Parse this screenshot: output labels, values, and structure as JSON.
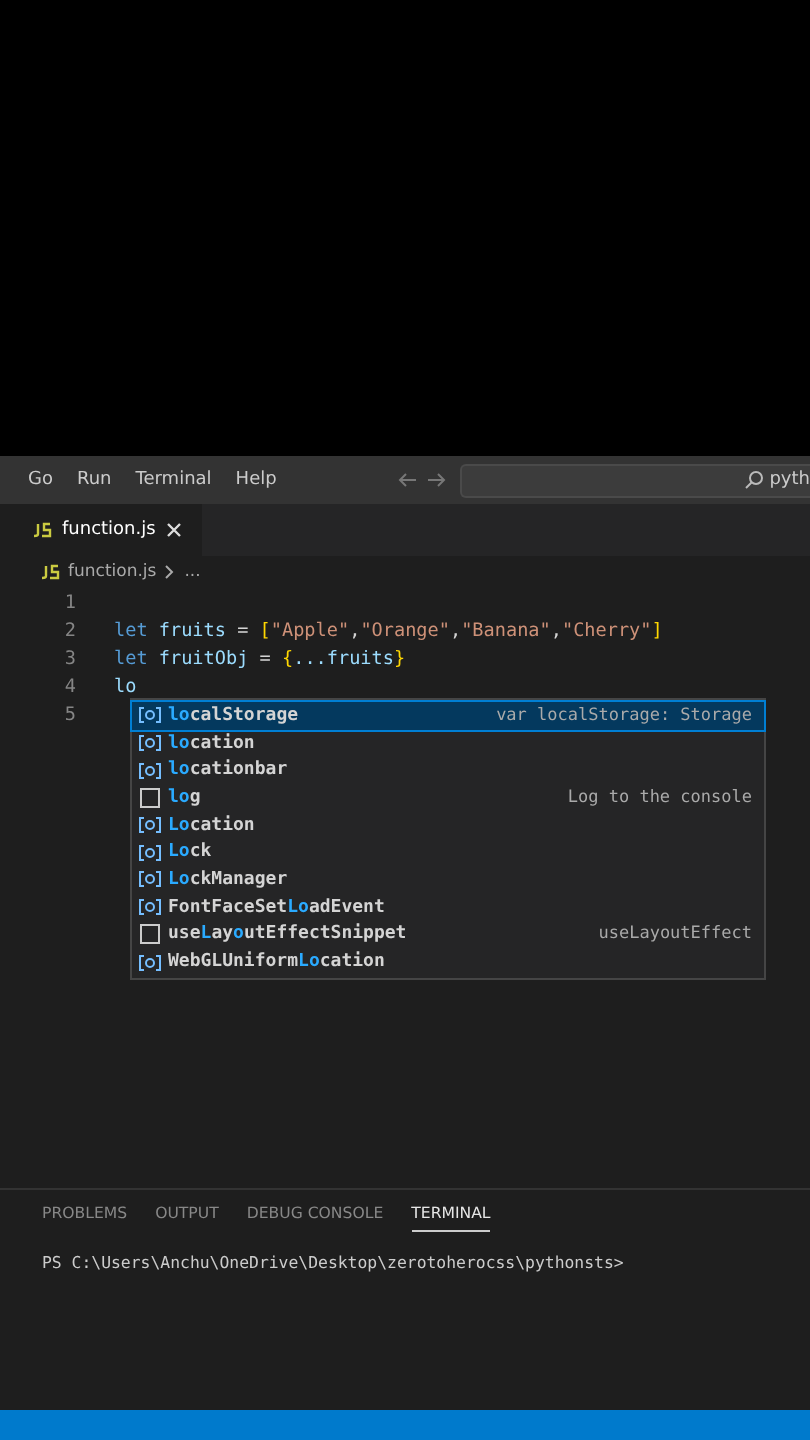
{
  "menu": [
    "Go",
    "Run",
    "Terminal",
    "Help"
  ],
  "search": {
    "value": "pyth"
  },
  "tabs": [
    {
      "label": "function.js",
      "selected": true
    }
  ],
  "breadcrumb": {
    "file": "function.js",
    "rest": "..."
  },
  "code": [
    {
      "number": "1"
    },
    {
      "number": "2",
      "tokens": [
        {
          "text": "let",
          "kind": "keyword"
        },
        {
          "text": " fruits ",
          "kind": "variable"
        },
        {
          "text": "=",
          "kind": "operator"
        },
        {
          "text": " [",
          "kind": "bracket"
        },
        {
          "text": "\"Apple\"",
          "kind": "string"
        },
        {
          "text": ",",
          "kind": "plain"
        },
        {
          "text": "\"Orange\"",
          "kind": "string"
        },
        {
          "text": ",",
          "kind": "plain"
        },
        {
          "text": "\"Banana\"",
          "kind": "string"
        },
        {
          "text": ",",
          "kind": "plain"
        },
        {
          "text": "\"Cherry\"",
          "kind": "string"
        },
        {
          "text": "]",
          "kind": "bracket"
        }
      ]
    },
    {
      "number": "3",
      "tokens": [
        {
          "text": "let",
          "kind": "keyword"
        },
        {
          "text": " fruitObj ",
          "kind": "variable"
        },
        {
          "text": "=",
          "kind": "operator"
        },
        {
          "text": " {",
          "kind": "bracket"
        },
        {
          "text": "...fruits",
          "kind": "variable"
        },
        {
          "text": "}",
          "kind": "bracket"
        }
      ]
    },
    {
      "number": "4",
      "tokens": [
        {
          "text": "lo",
          "kind": "variable"
        }
      ]
    },
    {
      "number": "5"
    }
  ],
  "suggestions": [
    {
      "kind": "variable",
      "selected": true,
      "parts": [
        {
          "text": "lo",
          "match": true
        },
        {
          "text": "calStorage",
          "match": false
        }
      ],
      "detail": "var localStorage: Storage"
    },
    {
      "kind": "variable",
      "selected": false,
      "parts": [
        {
          "text": "lo",
          "match": true
        },
        {
          "text": "cation",
          "match": false
        }
      ]
    },
    {
      "kind": "variable",
      "selected": false,
      "parts": [
        {
          "text": "lo",
          "match": true
        },
        {
          "text": "cationbar",
          "match": false
        }
      ]
    },
    {
      "kind": "snippet",
      "selected": false,
      "parts": [
        {
          "text": "lo",
          "match": true
        },
        {
          "text": "g",
          "match": false
        }
      ],
      "detail": "Log to the console"
    },
    {
      "kind": "variable",
      "selected": false,
      "parts": [
        {
          "text": "Lo",
          "match": true
        },
        {
          "text": "cation",
          "match": false
        }
      ]
    },
    {
      "kind": "variable",
      "selected": false,
      "parts": [
        {
          "text": "Lo",
          "match": true
        },
        {
          "text": "ck",
          "match": false
        }
      ]
    },
    {
      "kind": "variable",
      "selected": false,
      "parts": [
        {
          "text": "Lo",
          "match": true
        },
        {
          "text": "ckManager",
          "match": false
        }
      ]
    },
    {
      "kind": "variable",
      "selected": false,
      "parts": [
        {
          "text": "FontFaceSet",
          "match": false
        },
        {
          "text": "Lo",
          "match": true
        },
        {
          "text": "adEvent",
          "match": false
        }
      ]
    },
    {
      "kind": "snippet",
      "selected": false,
      "parts": [
        {
          "text": "use",
          "match": false
        },
        {
          "text": "L",
          "match": true
        },
        {
          "text": "ay",
          "match": false
        },
        {
          "text": "o",
          "match": true
        },
        {
          "text": "utEffectSnippet",
          "match": false
        }
      ],
      "detail": "useLayoutEffect"
    },
    {
      "kind": "variable",
      "selected": false,
      "parts": [
        {
          "text": "WebGLUniform",
          "match": false
        },
        {
          "text": "Lo",
          "match": true
        },
        {
          "text": "cation",
          "match": false
        }
      ]
    }
  ],
  "panel_tabs": [
    {
      "label": "PROBLEMS",
      "selected": false
    },
    {
      "label": "OUTPUT",
      "selected": false
    },
    {
      "label": "DEBUG CONSOLE",
      "selected": false
    },
    {
      "label": "TERMINAL",
      "selected": true
    }
  ],
  "terminal": "PS C:\\Users\\Anchu\\OneDrive\\Desktop\\zerotoherocss\\pythonsts>"
}
